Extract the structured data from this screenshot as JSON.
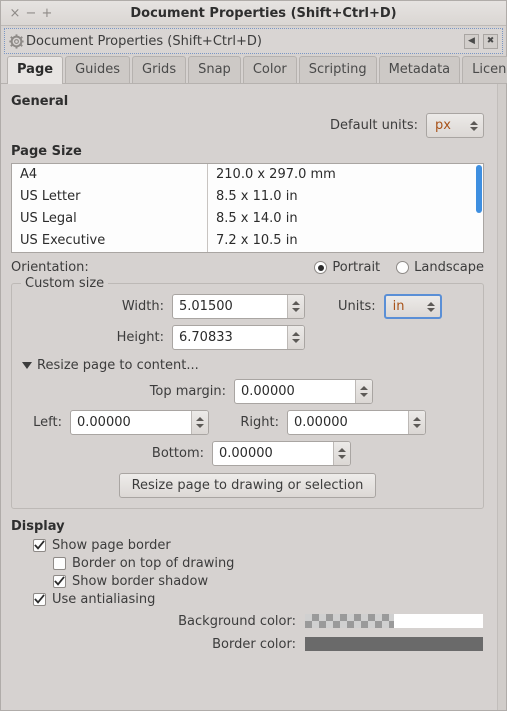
{
  "window": {
    "title": "Document Properties (Shift+Ctrl+D)",
    "close_label": "×",
    "minimize_label": "−",
    "maximize_label": "+"
  },
  "dialog_header": {
    "title": "Document Properties (Shift+Ctrl+D)",
    "icon": "gear-icon",
    "dock_label": "◀",
    "close_label": "✖"
  },
  "tabs": [
    {
      "label": "Page",
      "active": true
    },
    {
      "label": "Guides",
      "active": false
    },
    {
      "label": "Grids",
      "active": false
    },
    {
      "label": "Snap",
      "active": false
    },
    {
      "label": "Color",
      "active": false
    },
    {
      "label": "Scripting",
      "active": false
    },
    {
      "label": "Metadata",
      "active": false
    },
    {
      "label": "License",
      "active": false
    }
  ],
  "general": {
    "heading": "General",
    "default_units_label": "Default units:",
    "default_units_value": "px"
  },
  "page_size": {
    "heading": "Page Size",
    "rows": [
      {
        "name": "A4",
        "dimensions": "210.0 x 297.0 mm"
      },
      {
        "name": "US Letter",
        "dimensions": "8.5 x 11.0 in"
      },
      {
        "name": "US Legal",
        "dimensions": "8.5 x 14.0 in"
      },
      {
        "name": "US Executive",
        "dimensions": "7.2 x 10.5 in"
      }
    ]
  },
  "orientation": {
    "label": "Orientation:",
    "portrait_label": "Portrait",
    "landscape_label": "Landscape",
    "selected": "Portrait"
  },
  "custom_size": {
    "legend": "Custom size",
    "width_label": "Width:",
    "width_value": "5.01500",
    "height_label": "Height:",
    "height_value": "6.70833",
    "units_label": "Units:",
    "units_value": "in",
    "expander_label": "Resize page to content...",
    "top_margin_label": "Top margin:",
    "top_margin_value": "0.00000",
    "left_label": "Left:",
    "left_value": "0.00000",
    "right_label": "Right:",
    "right_value": "0.00000",
    "bottom_label": "Bottom:",
    "bottom_value": "0.00000",
    "resize_button_label": "Resize page to drawing or selection"
  },
  "display": {
    "heading": "Display",
    "show_page_border_label": "Show page border",
    "show_page_border_checked": true,
    "border_on_top_label": "Border on top of drawing",
    "border_on_top_checked": false,
    "show_border_shadow_label": "Show border shadow",
    "show_border_shadow_checked": true,
    "use_antialiasing_label": "Use antialiasing",
    "use_antialiasing_checked": true,
    "background_color_label": "Background color:",
    "background_color_value": "#ffffff",
    "border_color_label": "Border color:",
    "border_color_value": "#6a6a6a"
  },
  "colors": {
    "accent_blue": "#3e8fe0",
    "combo_text": "#a8531a",
    "window_bg": "#d6d2d0",
    "focus_border": "#5a8fd6"
  }
}
